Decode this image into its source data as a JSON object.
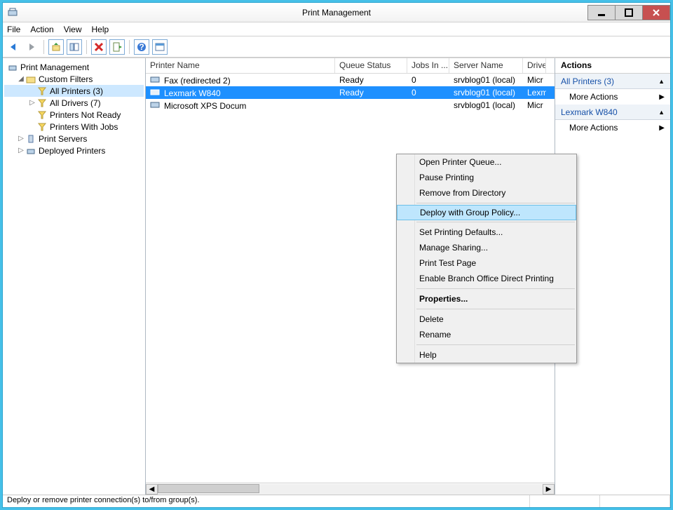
{
  "window": {
    "title": "Print Management"
  },
  "menu": {
    "file": "File",
    "action": "Action",
    "view": "View",
    "help": "Help"
  },
  "tree": {
    "root": "Print Management",
    "custom_filters": "Custom Filters",
    "all_printers": "All Printers (3)",
    "all_drivers": "All Drivers (7)",
    "printers_not_ready": "Printers Not Ready",
    "printers_with_jobs": "Printers With Jobs",
    "print_servers": "Print Servers",
    "deployed_printers": "Deployed Printers"
  },
  "columns": {
    "name": "Printer Name",
    "status": "Queue Status",
    "jobs": "Jobs In ...",
    "server": "Server Name",
    "driver": "Drive"
  },
  "rows": [
    {
      "name": "Fax (redirected 2)",
      "status": "Ready",
      "jobs": "0",
      "server": "srvblog01 (local)",
      "driver": "Micr"
    },
    {
      "name": "Lexmark W840",
      "status": "Ready",
      "jobs": "0",
      "server": "srvblog01 (local)",
      "driver": "Lexm"
    },
    {
      "name": "Microsoft XPS Docum",
      "status": "",
      "jobs": "",
      "server": "srvblog01 (local)",
      "driver": "Micr"
    }
  ],
  "context_menu": {
    "open_queue": "Open Printer Queue...",
    "pause": "Pause Printing",
    "remove_dir": "Remove from Directory",
    "deploy_gpo": "Deploy with Group Policy...",
    "set_defaults": "Set Printing Defaults...",
    "manage_sharing": "Manage Sharing...",
    "print_test": "Print Test Page",
    "enable_branch": "Enable Branch Office Direct Printing",
    "properties": "Properties...",
    "delete": "Delete",
    "rename": "Rename",
    "help": "Help"
  },
  "actions": {
    "title": "Actions",
    "section1": "All Printers (3)",
    "more1": "More Actions",
    "section2": "Lexmark W840",
    "more2": "More Actions"
  },
  "status": "Deploy or remove printer connection(s) to/from group(s)."
}
